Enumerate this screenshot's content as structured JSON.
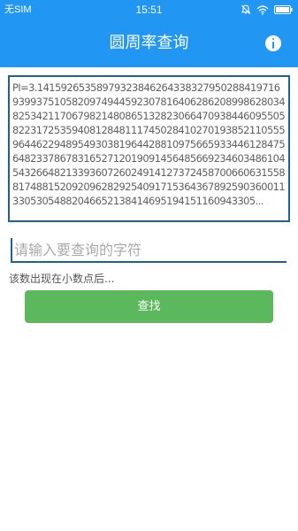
{
  "status_bar": {
    "carrier": "无SIM",
    "time": "15:51"
  },
  "app_bar": {
    "title": "圆周率查询",
    "info_icon": "info-icon"
  },
  "pi_display": {
    "text": "PI=3.14159265358979323846264338327950288419716939937510582097494459230781640628620899862803482534211706798214808651328230664709384460955058223172535940812848111745028410270193852110555964462294895493038196442881097566593344612847564823378678316527120190914564856692346034861045432664821339360726024914127372458700660631558817488152092096282925409171536436789259036001133053054882046652138414695194151160943305..."
  },
  "search": {
    "placeholder": "请输入要查询的字符",
    "value": ""
  },
  "result": {
    "text": "该数出现在小数点后..."
  },
  "find_button": {
    "label": "查找"
  },
  "colors": {
    "primary": "#2196f3",
    "border": "#1e5f9e",
    "button": "#5cb85c"
  }
}
